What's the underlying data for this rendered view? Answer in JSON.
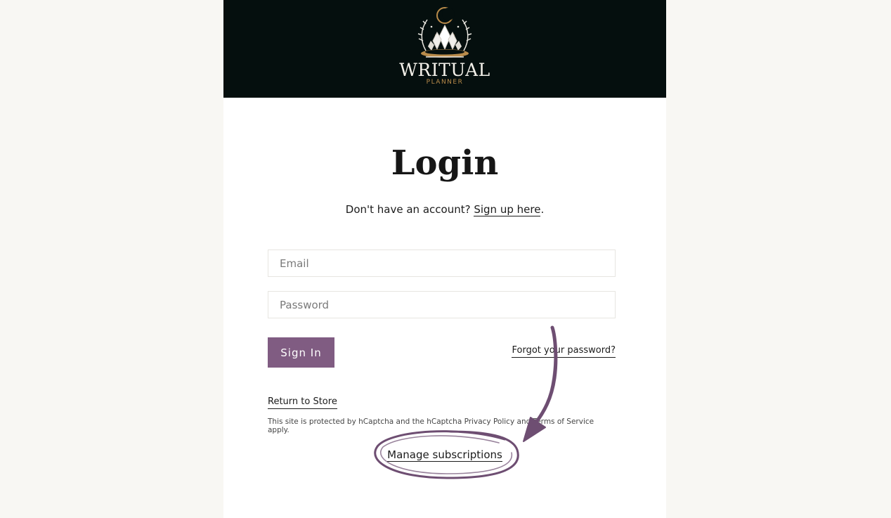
{
  "header": {
    "logo_word": "WRITUAL",
    "logo_sub": "PLANNER"
  },
  "login": {
    "title": "Login",
    "signup_prompt": "Don't have an account?",
    "signup_link": "Sign up here",
    "signup_suffix": ".",
    "email_placeholder": "Email",
    "password_placeholder": "Password",
    "signin_label": "Sign In",
    "forgot_label": "Forgot your password?",
    "return_label": "Return to Store",
    "captcha_note": "This site is protected by hCaptcha and the hCaptcha Privacy Policy and Terms of Service apply.",
    "manage_label": "Manage subscriptions"
  },
  "colors": {
    "header_bg": "#050f0e",
    "accent": "#805c82",
    "logo_gold": "#b98b4a",
    "annotation": "#6e4e72"
  },
  "icons": {
    "logo_emblem": "crystal-moon-emblem"
  }
}
